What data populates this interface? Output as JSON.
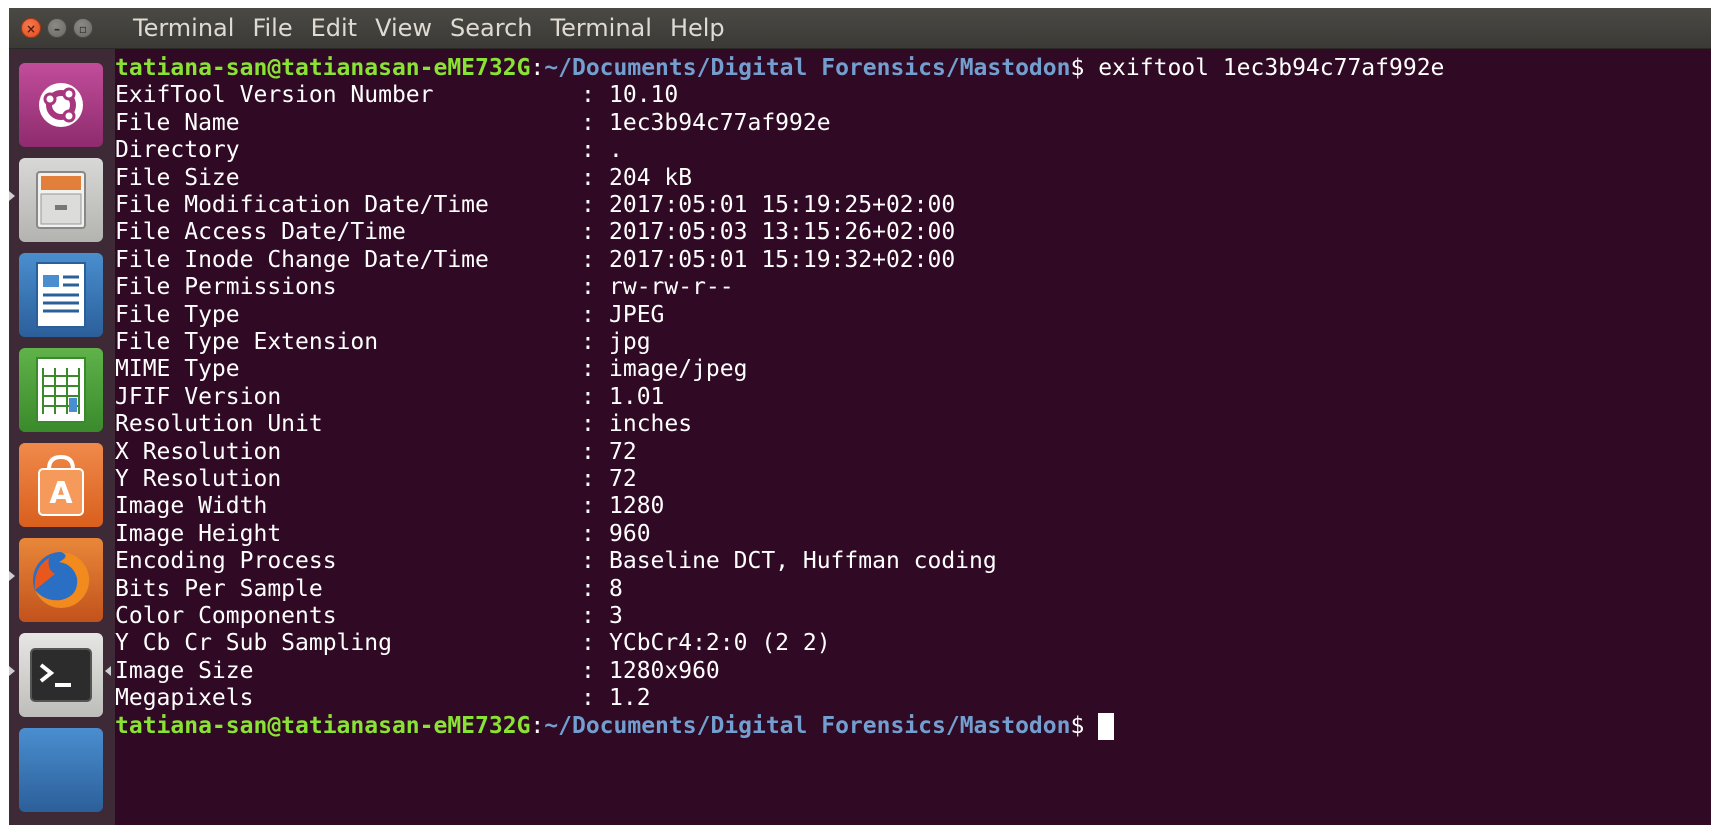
{
  "menubar": {
    "items": [
      "Terminal",
      "File",
      "Edit",
      "View",
      "Search",
      "Terminal",
      "Help"
    ]
  },
  "launcher": {
    "items": [
      "ubuntu-dash-icon",
      "file-cabinet-icon",
      "writer-document-icon",
      "calc-spreadsheet-icon",
      "software-center-icon",
      "firefox-icon",
      "terminal-icon",
      "partial-app-icon"
    ]
  },
  "terminal": {
    "prompt": {
      "user_host": "tatiana-san@tatianasan-eME732G",
      "colon": ":",
      "path": "~/Documents/Digital Forensics/Mastodon",
      "symbol": "$"
    },
    "command": "exiftool 1ec3b94c77af992e",
    "separator": ":",
    "rows": [
      {
        "key": "ExifTool Version Number",
        "value": "10.10"
      },
      {
        "key": "File Name",
        "value": "1ec3b94c77af992e"
      },
      {
        "key": "Directory",
        "value": "."
      },
      {
        "key": "File Size",
        "value": "204 kB"
      },
      {
        "key": "File Modification Date/Time",
        "value": "2017:05:01 15:19:25+02:00"
      },
      {
        "key": "File Access Date/Time",
        "value": "2017:05:03 13:15:26+02:00"
      },
      {
        "key": "File Inode Change Date/Time",
        "value": "2017:05:01 15:19:32+02:00"
      },
      {
        "key": "File Permissions",
        "value": "rw-rw-r--"
      },
      {
        "key": "File Type",
        "value": "JPEG"
      },
      {
        "key": "File Type Extension",
        "value": "jpg"
      },
      {
        "key": "MIME Type",
        "value": "image/jpeg"
      },
      {
        "key": "JFIF Version",
        "value": "1.01"
      },
      {
        "key": "Resolution Unit",
        "value": "inches"
      },
      {
        "key": "X Resolution",
        "value": "72"
      },
      {
        "key": "Y Resolution",
        "value": "72"
      },
      {
        "key": "Image Width",
        "value": "1280"
      },
      {
        "key": "Image Height",
        "value": "960"
      },
      {
        "key": "Encoding Process",
        "value": "Baseline DCT, Huffman coding"
      },
      {
        "key": "Bits Per Sample",
        "value": "8"
      },
      {
        "key": "Color Components",
        "value": "3"
      },
      {
        "key": "Y Cb Cr Sub Sampling",
        "value": "YCbCr4:2:0 (2 2)"
      },
      {
        "key": "Image Size",
        "value": "1280x960"
      },
      {
        "key": "Megapixels",
        "value": "1.2"
      }
    ]
  },
  "colors": {
    "terminal_bg": "#300a24",
    "prompt_user": "#8ae234",
    "prompt_path": "#729fcf",
    "text": "#ffffff"
  }
}
